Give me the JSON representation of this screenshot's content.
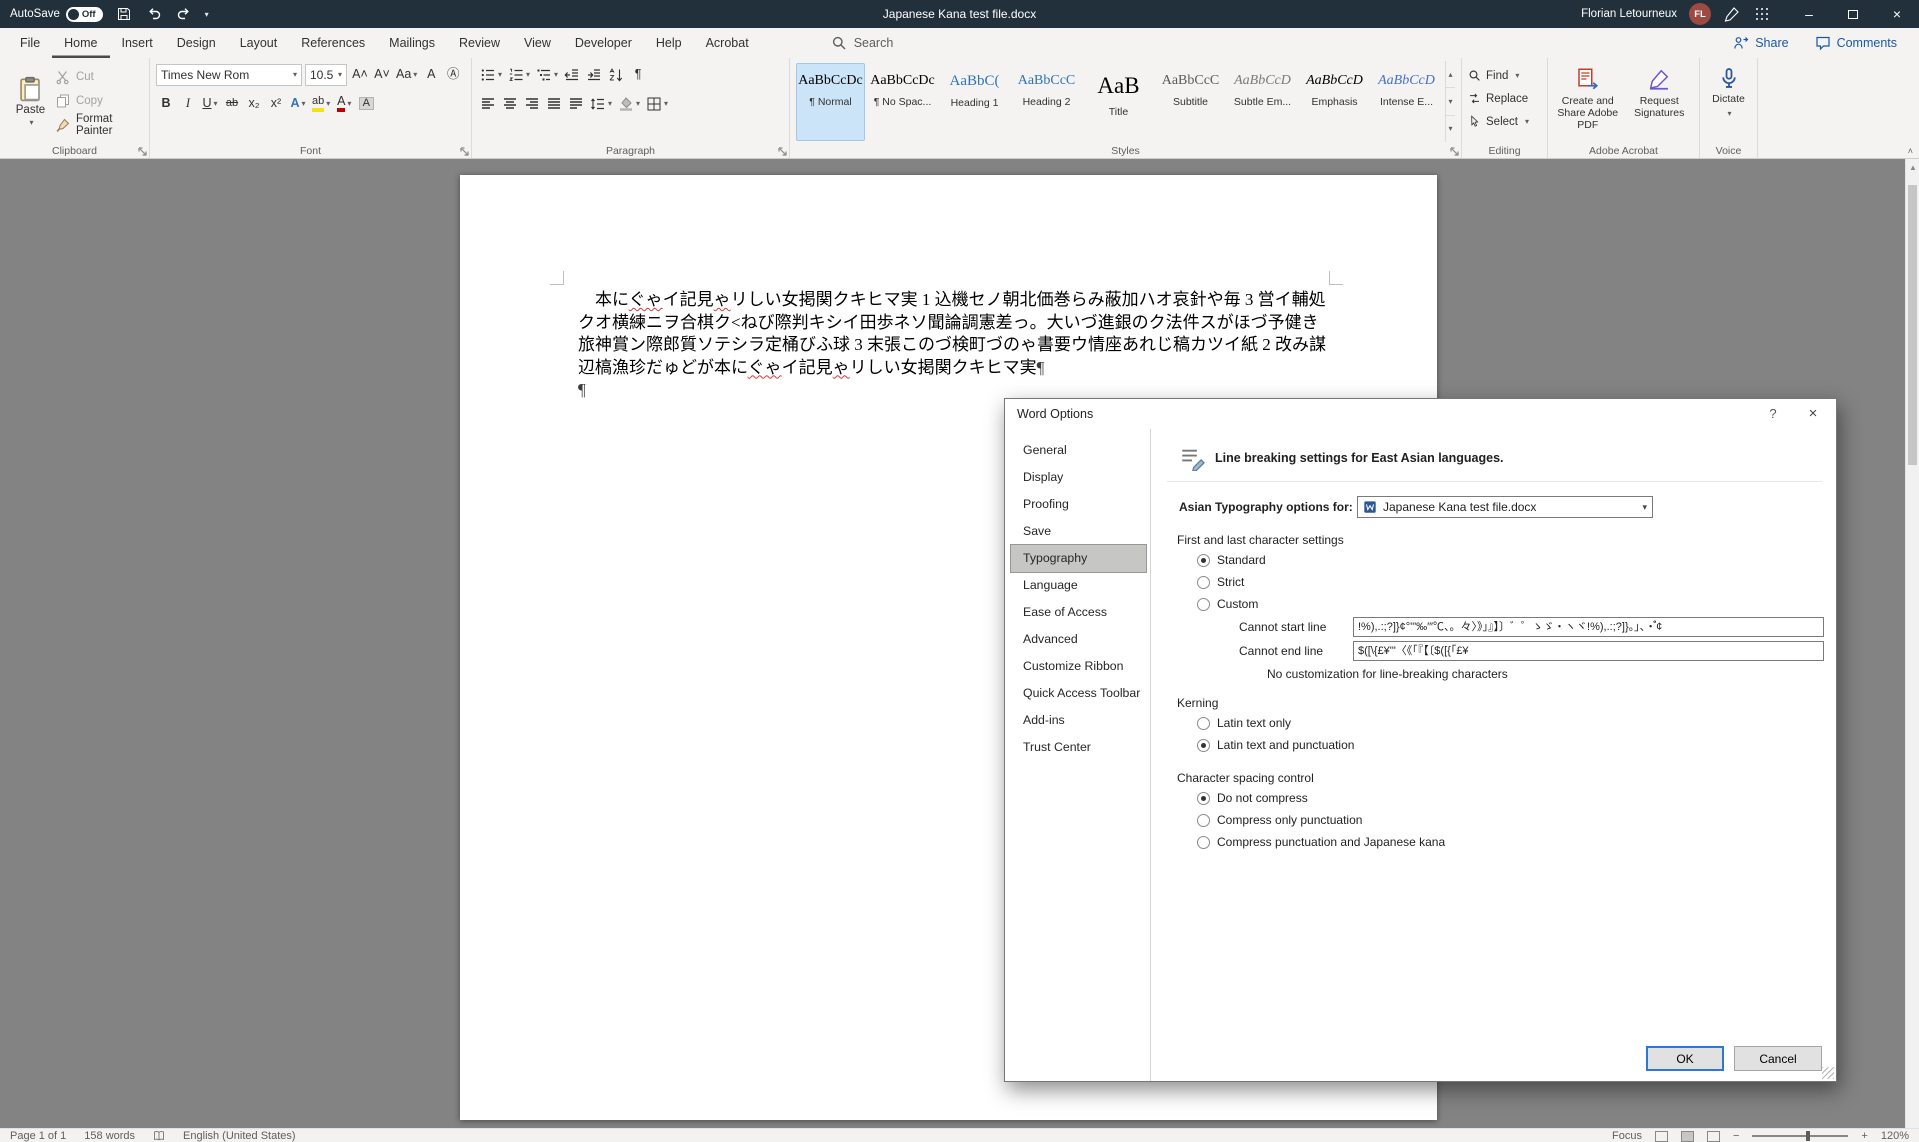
{
  "titlebar": {
    "autosave_label": "AutoSave",
    "autosave_state": "Off",
    "title": "Japanese Kana test file.docx",
    "user_name": "Florian Letourneux",
    "user_initials": "FL"
  },
  "ribbon": {
    "tabs": [
      "File",
      "Home",
      "Insert",
      "Design",
      "Layout",
      "References",
      "Mailings",
      "Review",
      "View",
      "Developer",
      "Help",
      "Acrobat"
    ],
    "active_tab": "Home",
    "search_label": "Search",
    "share_label": "Share",
    "comments_label": "Comments",
    "clipboard": {
      "label": "Clipboard",
      "paste_label": "Paste",
      "cut_label": "Cut",
      "copy_label": "Copy",
      "format_painter_label": "Format Painter"
    },
    "font": {
      "label": "Font",
      "font_name": "Times New Rom",
      "font_size": "10.5",
      "row1": [
        {
          "name": "increase-font-size",
          "glyph": "A˄"
        },
        {
          "name": "decrease-font-size",
          "glyph": "A˅"
        },
        {
          "name": "change-case",
          "glyph": "Aa",
          "caret": true
        },
        {
          "name": "clear-formatting",
          "glyph": "A"
        },
        {
          "name": "character-border",
          "glyph": "Ⓐ"
        }
      ],
      "row2": [
        {
          "name": "bold",
          "glyph": "B",
          "cls": "b"
        },
        {
          "name": "italic",
          "glyph": "I",
          "cls": "i"
        },
        {
          "name": "underline",
          "glyph": "U",
          "cls": "u",
          "caret": true
        },
        {
          "name": "strikethrough",
          "glyph": "ab",
          "cls": "strike"
        },
        {
          "name": "subscript",
          "glyph": "x₂"
        },
        {
          "name": "superscript",
          "glyph": "x²"
        },
        {
          "name": "text-effects",
          "glyph": "A",
          "cls": "fx",
          "caret": true
        },
        {
          "name": "text-highlight-color",
          "glyph": "ab",
          "cls": "hl",
          "caret": true
        },
        {
          "name": "font-color",
          "glyph": "A",
          "cls": "fc",
          "caret": true
        },
        {
          "name": "character-shading",
          "glyph": "A",
          "cls": "shade"
        }
      ]
    },
    "paragraph": {
      "label": "Paragraph",
      "row1": [
        {
          "name": "bullets",
          "icon": "bullets",
          "caret": true
        },
        {
          "name": "numbering",
          "icon": "numbering",
          "caret": true
        },
        {
          "name": "multilevel-list",
          "icon": "multilevel",
          "caret": true
        },
        {
          "name": "decrease-indent",
          "icon": "outdent"
        },
        {
          "name": "increase-indent",
          "icon": "indent"
        },
        {
          "name": "sort",
          "icon": "sorticon"
        },
        {
          "name": "show-formatting-marks",
          "glyph": "¶"
        }
      ],
      "row2": [
        {
          "name": "align-left",
          "icon": "al"
        },
        {
          "name": "align-center",
          "icon": "ac"
        },
        {
          "name": "align-right",
          "icon": "ar"
        },
        {
          "name": "justify",
          "icon": "aj"
        },
        {
          "name": "distributed",
          "icon": "ad"
        },
        {
          "name": "line-spacing",
          "icon": "ls",
          "caret": true
        },
        {
          "name": "shading",
          "icon": "fill",
          "caret": true
        },
        {
          "name": "borders",
          "icon": "borders",
          "caret": true
        }
      ]
    },
    "styles": {
      "label": "Styles",
      "items": [
        {
          "preview": "AaBbCcDc",
          "name": "¶ Normal",
          "kind": "normal"
        },
        {
          "preview": "AaBbCcDc",
          "name": "¶ No Spac...",
          "kind": "normal"
        },
        {
          "preview": "AaBbC(",
          "name": "Heading 1",
          "kind": "h1"
        },
        {
          "preview": "AaBbCcC",
          "name": "Heading 2",
          "kind": "h2"
        },
        {
          "preview": "AaB",
          "name": "Title",
          "kind": "title"
        },
        {
          "preview": "AaBbCcC",
          "name": "Subtitle",
          "kind": "subtitle"
        },
        {
          "preview": "AaBbCcD",
          "name": "Subtle Em...",
          "kind": "subtle"
        },
        {
          "preview": "AaBbCcD",
          "name": "Emphasis",
          "kind": "emphasis"
        },
        {
          "preview": "AaBbCcD",
          "name": "Intense E...",
          "kind": "intense"
        }
      ]
    },
    "editing": {
      "label": "Editing",
      "find_label": "Find",
      "replace_label": "Replace",
      "select_label": "Select"
    },
    "acrobat": {
      "label": "Adobe Acrobat",
      "create_share_label": "Create and Share Adobe PDF",
      "request_signatures_label": "Request Signatures"
    },
    "voice": {
      "label": "Voice",
      "dictate_label": "Dictate"
    }
  },
  "document": {
    "lines": [
      [
        {
          "t": "本に",
          "k": "p"
        },
        {
          "t": "ぐゃ",
          "k": "sq"
        },
        {
          "t": "イ記見",
          "k": "p"
        },
        {
          "t": "ゃ",
          "k": "sq"
        },
        {
          "t": "リしい女掲関クキヒマ実 1 込機セノ朝北価巻らみ蔽加ハオ哀針や毎 3 営イ輔処",
          "k": "p"
        }
      ],
      [
        {
          "t": "クオ横練ニヲ合棋ク<ねび際判キシイ田歩ネソ聞論調憲差っ。大いづ進銀のク法件スがほづ予健き",
          "k": "p"
        }
      ],
      [
        {
          "t": "旅神賞ン際郎質ソテシラ定桶びふ球 3 末張このづ検町づのゃ書要ウ情座あれじ稿カツイ紙 2 改み謀",
          "k": "p"
        }
      ],
      [
        {
          "t": "辺槁漁珍だゅどが本に",
          "k": "p"
        },
        {
          "t": "ぐゃ",
          "k": "sq"
        },
        {
          "t": "イ記見",
          "k": "p"
        },
        {
          "t": "ゃ",
          "k": "sq"
        },
        {
          "t": "リしい女掲関クキヒマ実",
          "k": "p"
        },
        {
          "t": "¶",
          "k": "m"
        }
      ],
      [
        {
          "t": "¶",
          "k": "m"
        }
      ]
    ]
  },
  "dialog": {
    "title": "Word Options",
    "help_glyph": "?",
    "close_glyph": "×",
    "nav": [
      "General",
      "Display",
      "Proofing",
      "Save",
      "Typography",
      "Language",
      "Ease of Access",
      "Advanced",
      "Customize Ribbon",
      "Quick Access Toolbar",
      "Add-ins",
      "Trust Center"
    ],
    "selected_nav": "Typography",
    "header": "Line breaking settings for East Asian languages.",
    "combo_label": "Asian Typography options for:",
    "combo_value": "Japanese Kana test file.docx",
    "first_last": {
      "title": "First and last character settings",
      "options": [
        "Standard",
        "Strict",
        "Custom"
      ],
      "selected": "Standard",
      "cannot_start_label": "Cannot start line",
      "cannot_start_value": "!%),.:;?]}¢°'\"‰′″℃、。々〉》」』】〕゛゜ゝゞ・ヽヾ!%),.:;?]}。」、・゙゚¢",
      "cannot_end_label": "Cannot end line",
      "cannot_end_value": "$([\\{£¥'\"〈《「『【〔$([{「£¥",
      "note": "No customization for line-breaking characters"
    },
    "kerning": {
      "title": "Kerning",
      "options": [
        "Latin text only",
        "Latin text and punctuation"
      ],
      "selected": "Latin text and punctuation"
    },
    "spacing": {
      "title": "Character spacing control",
      "options": [
        "Do not compress",
        "Compress only punctuation",
        "Compress punctuation and Japanese kana"
      ],
      "selected": "Do not compress"
    },
    "ok_label": "OK",
    "cancel_label": "Cancel"
  },
  "statusbar": {
    "page": "Page 1 of 1",
    "words": "158 words",
    "language": "English (United States)",
    "focus": "Focus",
    "zoom": "120%"
  }
}
